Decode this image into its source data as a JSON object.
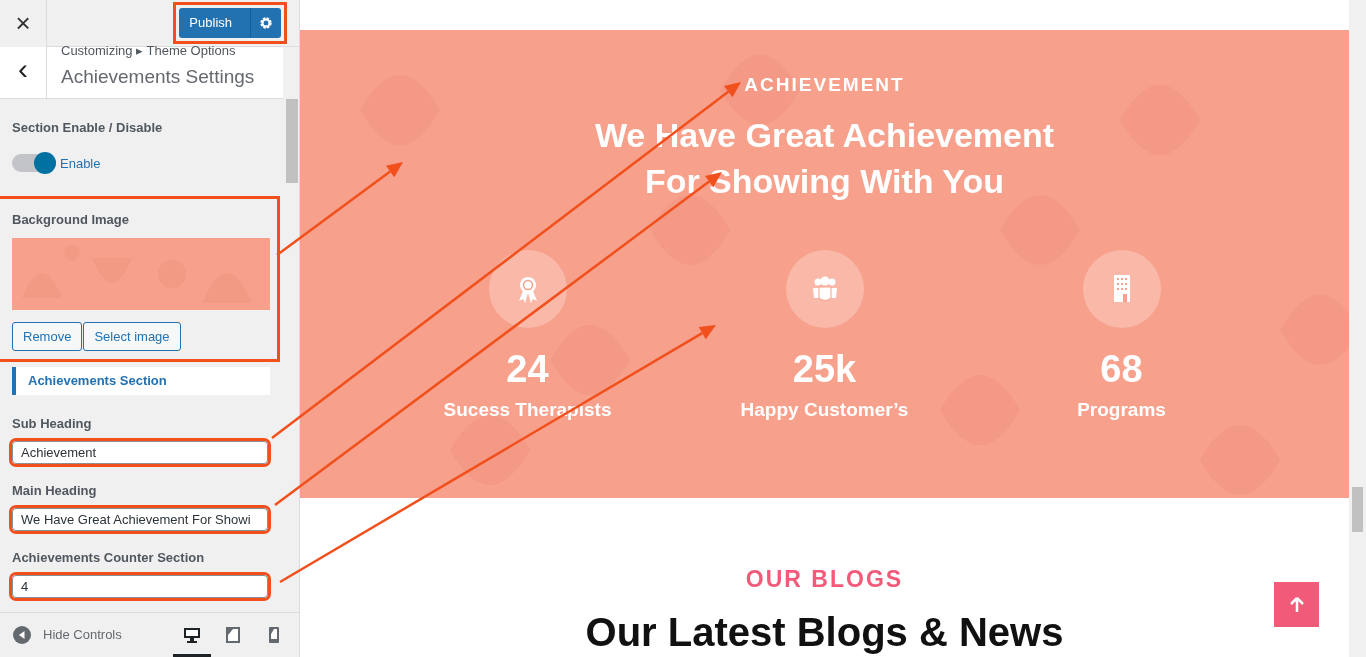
{
  "header": {
    "close": "×",
    "publish": {
      "label": "Publish",
      "highlighted": true
    }
  },
  "section_header": {
    "back": "‹",
    "breadcrumb": "Customizing ▸ Theme Options",
    "title": "Achievements Settings"
  },
  "controls": [
    {
      "kind": "toggle",
      "label": "Section Enable / Disable",
      "text": "Enable",
      "on": true
    },
    {
      "label": "Background Image",
      "buttons": [
        "Remove",
        "Select image"
      ],
      "highlighted": true
    },
    {
      "kind": "section",
      "label": "Achievements Section"
    },
    {
      "kind": "text",
      "label": "Sub Heading",
      "value": "Achievement",
      "highlighted": true
    },
    {
      "kind": "text",
      "label": "Main Heading",
      "value": "We Have Great Achievement For Showi",
      "highlighted": true
    },
    {
      "kind": "text",
      "label": "Achievements Counter Section",
      "value": "4",
      "highlighted": true
    }
  ],
  "footer": {
    "hide_controls": "Hide Controls",
    "devices": [
      {
        "kind": "desktop",
        "selected": true
      },
      {
        "kind": "tablet",
        "selected": false
      },
      {
        "kind": "mobile",
        "selected": false
      }
    ]
  },
  "preview": {
    "achievement": {
      "subheading": "ACHIEVEMENT",
      "heading_lines": [
        "We Have Great Achievement",
        "For Showing With You"
      ],
      "counters": [
        {
          "number": "24",
          "label": "Sucess Therapists"
        },
        {
          "number": "25k",
          "label": "Happy Customer’s"
        },
        {
          "number": "68",
          "label": "Programs"
        }
      ]
    },
    "blogs": {
      "subheading": "OUR BLOGS",
      "heading": "Our Latest Blogs & News"
    }
  }
}
